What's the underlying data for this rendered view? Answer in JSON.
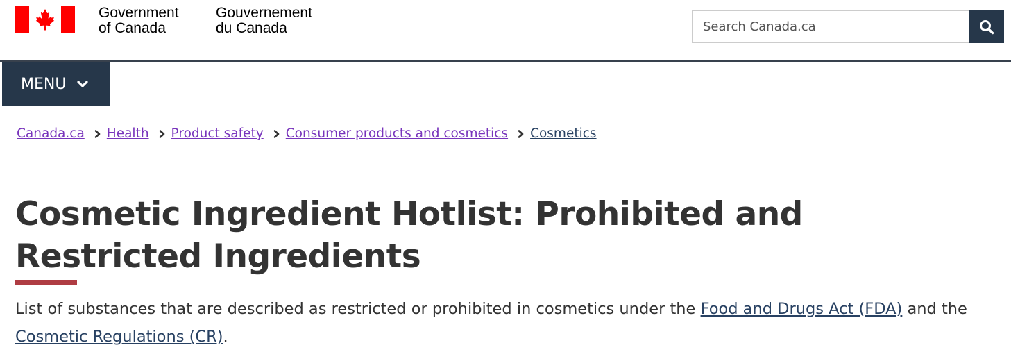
{
  "header": {
    "signature_en_line1": "Government",
    "signature_en_line2": "of Canada",
    "signature_fr_line1": "Gouvernement",
    "signature_fr_line2": "du Canada",
    "flag_color": "#ff0000",
    "search": {
      "placeholder": "Search Canada.ca",
      "button_icon": "search-icon"
    }
  },
  "menu": {
    "label": "MENU",
    "icon": "chevron-down-icon"
  },
  "breadcrumb": {
    "items": [
      {
        "label": "Canada.ca"
      },
      {
        "label": "Health"
      },
      {
        "label": "Product safety"
      },
      {
        "label": "Consumer products and cosmetics"
      },
      {
        "label": "Cosmetics"
      }
    ]
  },
  "page": {
    "title": "Cosmetic Ingredient Hotlist: Prohibited and Restricted Ingredients",
    "intro": {
      "text_before": "List of substances that are described as restricted or prohibited in cosmetics under the ",
      "link1": "Food and Drugs Act (FDA)",
      "text_middle": " and the ",
      "link2": "Cosmetic Regulations (CR)",
      "text_after": "."
    }
  },
  "colors": {
    "nav_dark": "#26374a",
    "visited_link": "#7834bc",
    "link": "#284162",
    "title_accent": "#af3c43"
  }
}
